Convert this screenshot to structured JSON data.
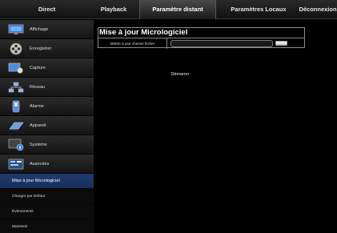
{
  "topnav": {
    "items": [
      {
        "label": "Direct"
      },
      {
        "label": "Playback"
      },
      {
        "label": "Paramètre distant"
      },
      {
        "label": "Paramètres Locaux"
      },
      {
        "label": "Déconnexion"
      }
    ],
    "active": "Paramètre distant"
  },
  "sidebar": {
    "items": [
      {
        "label": "Affichage",
        "icon": "monitor-icon"
      },
      {
        "label": "Enregistrer",
        "icon": "film-reel-icon"
      },
      {
        "label": "Capture",
        "icon": "capture-icon"
      },
      {
        "label": "Réseau",
        "icon": "network-icon"
      },
      {
        "label": "Alarme",
        "icon": "alarm-icon"
      },
      {
        "label": "Appareil",
        "icon": "disk-icon"
      },
      {
        "label": "Système",
        "icon": "system-icon"
      },
      {
        "label": "Avancées",
        "icon": "advanced-icon"
      }
    ],
    "subitems": [
      {
        "label": "Mise à jour Micrologiciel",
        "active": true
      },
      {
        "label": "Charger par Défaut",
        "active": false
      },
      {
        "label": "Évènements",
        "active": false
      },
      {
        "label": "Maintenir",
        "active": false
      }
    ]
  },
  "main": {
    "panel_title": "Mise à jour Micrologiciel",
    "path_label": "Mettre à jour chemin fichier",
    "path_value": "",
    "start_label": "Démarrer"
  },
  "colors": {
    "active_sub_bg": "#1f3a6e",
    "background": "#000000"
  }
}
